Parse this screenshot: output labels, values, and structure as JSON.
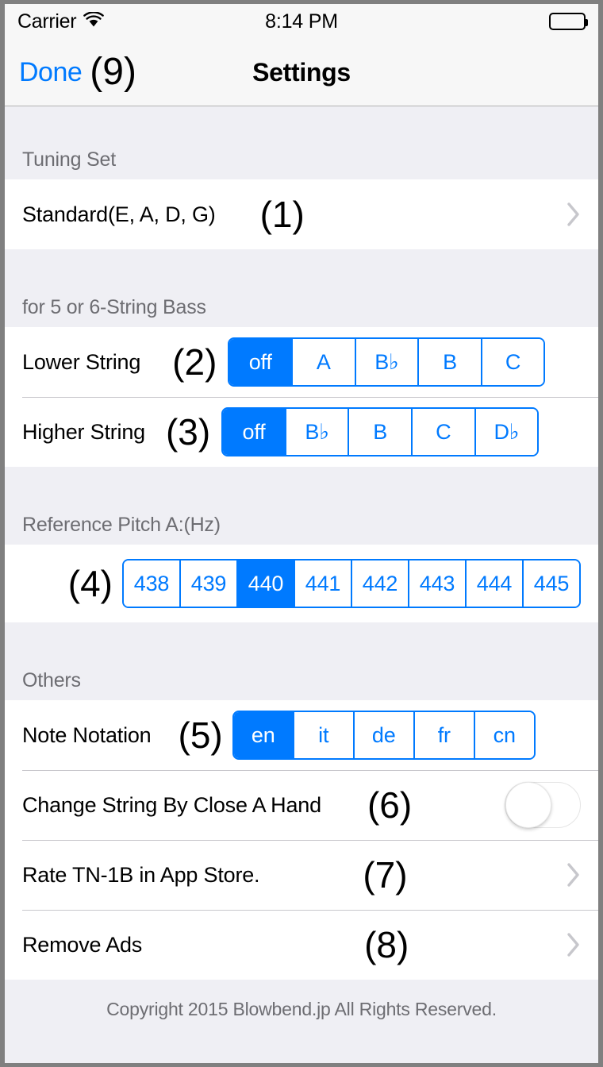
{
  "status_bar": {
    "carrier": "Carrier",
    "wifi_icon": "wifi-icon",
    "time": "8:14 PM",
    "battery_icon": "battery-full-icon"
  },
  "nav_bar": {
    "done_label": "Done",
    "done_annotation": "(9)",
    "title": "Settings"
  },
  "sections": {
    "tuning_set": {
      "header": "Tuning Set",
      "row": {
        "label": "Standard(E, A, D, G)",
        "annotation": "(1)",
        "accessory": "chevron-right-icon"
      }
    },
    "bass_strings": {
      "header": "for 5 or 6-String Bass",
      "lower": {
        "label": "Lower String",
        "annotation": "(2)",
        "options": [
          "off",
          "A",
          "B♭",
          "B",
          "C"
        ],
        "selected_index": 0,
        "selected_value": "off"
      },
      "higher": {
        "label": "Higher String",
        "annotation": "(3)",
        "options": [
          "off",
          "B♭",
          "B",
          "C",
          "D♭"
        ],
        "selected_index": 0,
        "selected_value": "off"
      }
    },
    "reference_pitch": {
      "header": "Reference Pitch A:(Hz)",
      "annotation": "(4)",
      "options": [
        "438",
        "439",
        "440",
        "441",
        "442",
        "443",
        "444",
        "445"
      ],
      "selected_index": 2,
      "selected_value": "440"
    },
    "others": {
      "header": "Others",
      "note_notation": {
        "label": "Note Notation",
        "annotation": "(5)",
        "options": [
          "en",
          "it",
          "de",
          "fr",
          "cn"
        ],
        "selected_index": 0,
        "selected_value": "en"
      },
      "change_string": {
        "label": "Change String By Close A Hand",
        "annotation": "(6)",
        "toggle_state": "off"
      },
      "rate_app": {
        "label": "Rate TN-1B in App Store.",
        "annotation": "(7)",
        "accessory": "chevron-right-icon"
      },
      "remove_ads": {
        "label": "Remove Ads",
        "annotation": "(8)",
        "accessory": "chevron-right-icon"
      }
    }
  },
  "footer": {
    "copyright": "Copyright 2015 Blowbend.jp All Rights Reserved."
  },
  "colors": {
    "accent_blue": "#007aff",
    "group_background": "#efeff4",
    "cell_background": "#ffffff",
    "header_text": "#6d6d72",
    "separator": "#c8c7cc"
  }
}
